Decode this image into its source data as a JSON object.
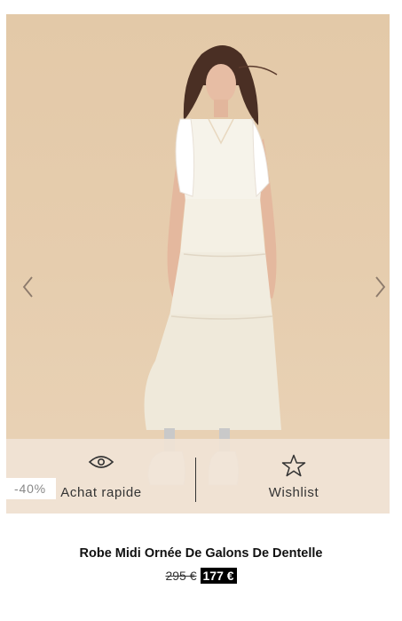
{
  "product": {
    "name": "Robe Midi Ornée De Galons De Dentelle",
    "old_price": "295 €",
    "new_price": "177 €",
    "discount_badge": "-40%"
  },
  "actions": {
    "quick_view_label": "Achat rapide",
    "quick_view_icon": "eye-icon",
    "wishlist_label": "Wishlist",
    "wishlist_icon": "star-icon"
  },
  "carousel": {
    "prev_icon": "chevron-left-icon",
    "next_icon": "chevron-right-icon"
  }
}
